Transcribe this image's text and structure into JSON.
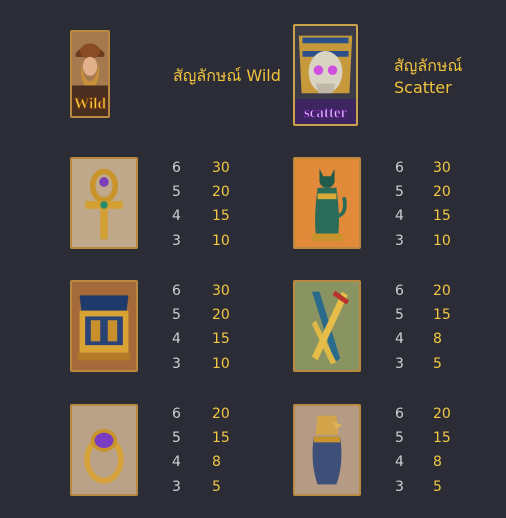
{
  "symbols": {
    "wild": {
      "icon": "wild-icon",
      "title": "สัญลักษณ์ Wild"
    },
    "scatter": {
      "icon": "scatter-icon",
      "title_line1": "สัญลักษณ์",
      "title_line2": "Scatter"
    },
    "ankh": {
      "icon": "ankh-icon",
      "pays": [
        {
          "count": "6",
          "value": "30"
        },
        {
          "count": "5",
          "value": "20"
        },
        {
          "count": "4",
          "value": "15"
        },
        {
          "count": "3",
          "value": "10"
        }
      ]
    },
    "cat": {
      "icon": "bastet-cat-icon",
      "pays": [
        {
          "count": "6",
          "value": "30"
        },
        {
          "count": "5",
          "value": "20"
        },
        {
          "count": "4",
          "value": "15"
        },
        {
          "count": "3",
          "value": "10"
        }
      ]
    },
    "chest": {
      "icon": "treasure-chest-icon",
      "pays": [
        {
          "count": "6",
          "value": "30"
        },
        {
          "count": "5",
          "value": "20"
        },
        {
          "count": "4",
          "value": "15"
        },
        {
          "count": "3",
          "value": "10"
        }
      ]
    },
    "daggers": {
      "icon": "crossed-daggers-icon",
      "pays": [
        {
          "count": "6",
          "value": "20"
        },
        {
          "count": "5",
          "value": "15"
        },
        {
          "count": "4",
          "value": "8"
        },
        {
          "count": "3",
          "value": "5"
        }
      ]
    },
    "ring": {
      "icon": "scarab-ring-icon",
      "pays": [
        {
          "count": "6",
          "value": "20"
        },
        {
          "count": "5",
          "value": "15"
        },
        {
          "count": "4",
          "value": "8"
        },
        {
          "count": "3",
          "value": "5"
        }
      ]
    },
    "jar": {
      "icon": "canopic-jar-icon",
      "pays": [
        {
          "count": "6",
          "value": "20"
        },
        {
          "count": "5",
          "value": "15"
        },
        {
          "count": "4",
          "value": "8"
        },
        {
          "count": "3",
          "value": "5"
        }
      ]
    }
  },
  "colors": {
    "background": "#2c2c37",
    "accent": "#f0c33c",
    "count_text": "#cfcfd8",
    "frame": "#b8893f"
  }
}
